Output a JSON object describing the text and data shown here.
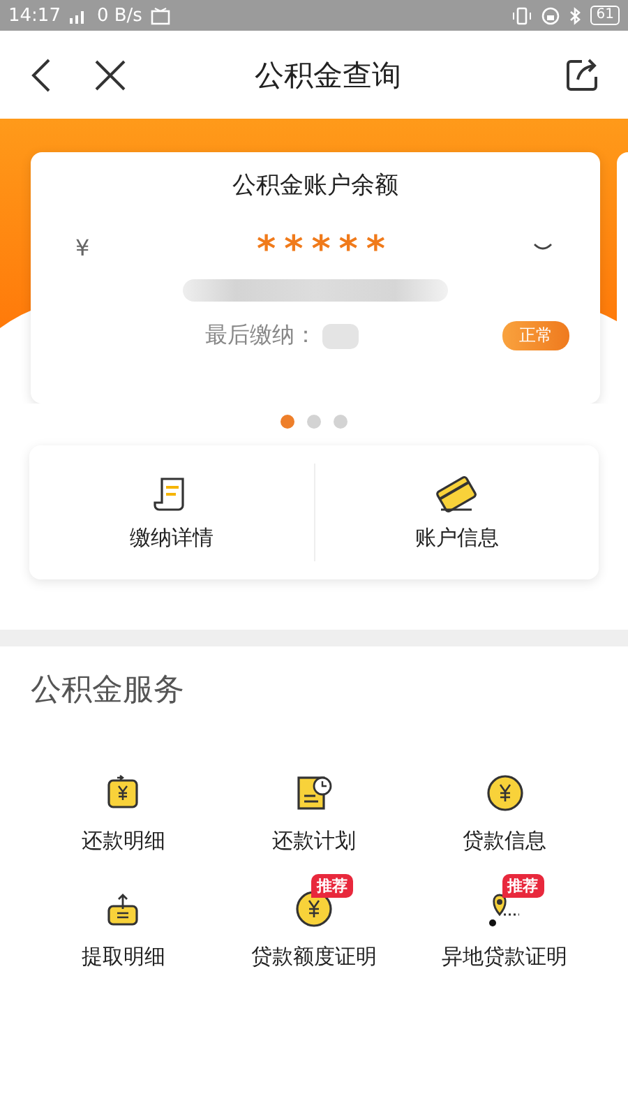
{
  "status_bar": {
    "time": "14:17",
    "network_speed": "0 B/s",
    "battery": "61"
  },
  "nav": {
    "title": "公积金查询"
  },
  "balance_card": {
    "title": "公积金账户余额",
    "currency": "¥",
    "amount": "*****",
    "last_payment_label": "最后缴纳：",
    "status": "正常"
  },
  "carousel": {
    "dots": [
      {
        "selected": true
      },
      {
        "selected": false
      },
      {
        "selected": false
      }
    ]
  },
  "quick_actions": [
    {
      "label": "缴纳详情",
      "kind": "receipt"
    },
    {
      "label": "账户信息",
      "kind": "card"
    }
  ],
  "services": {
    "title": "公积金服务",
    "items": [
      {
        "label": "还款明细",
        "kind": "repay"
      },
      {
        "label": "还款计划",
        "kind": "plan"
      },
      {
        "label": "贷款信息",
        "kind": "coin"
      },
      {
        "label": "提取明细",
        "kind": "withdraw"
      },
      {
        "label": "贷款额度证明",
        "kind": "coin",
        "badge": "推荐"
      },
      {
        "label": "异地贷款证明",
        "kind": "location",
        "badge": "推荐"
      }
    ]
  }
}
